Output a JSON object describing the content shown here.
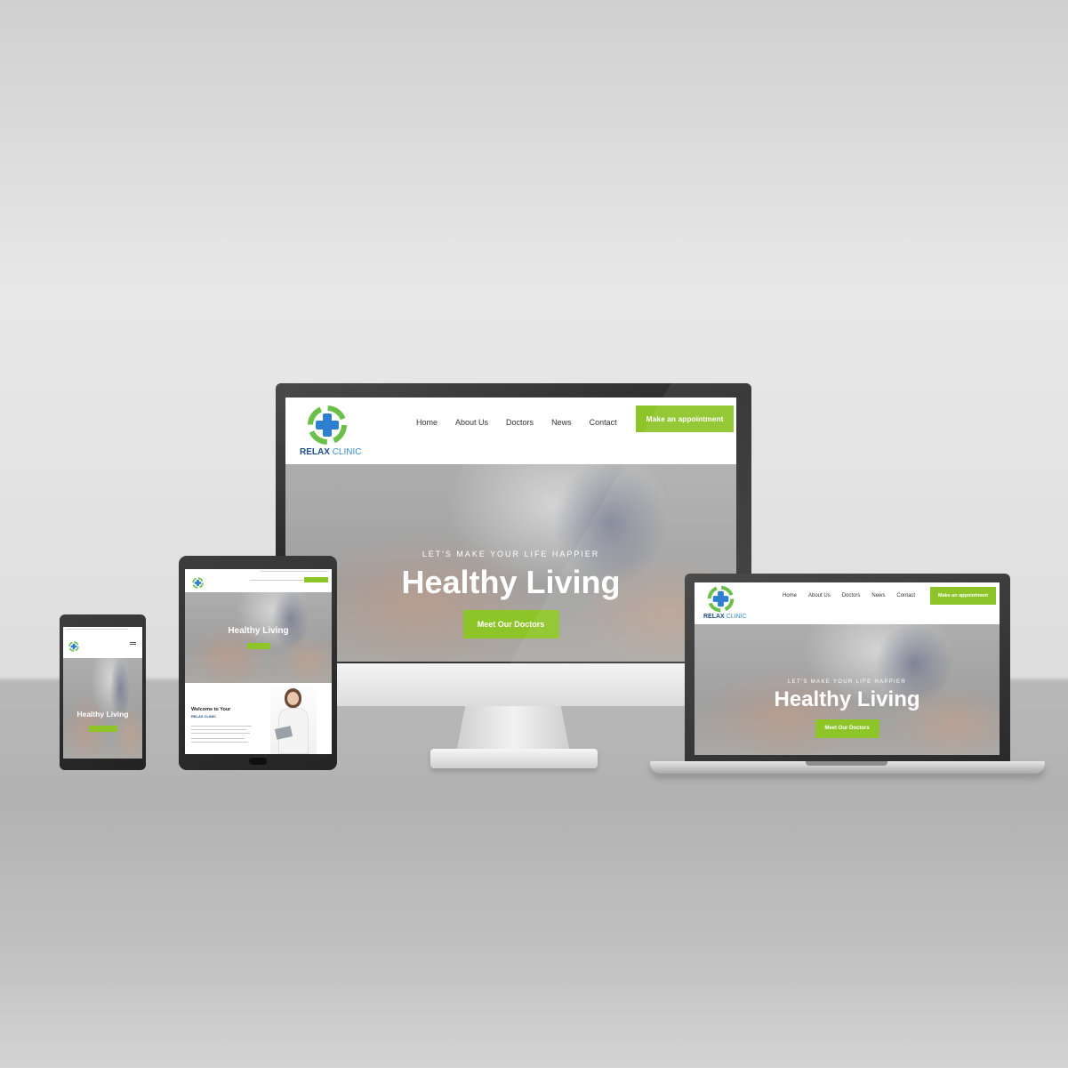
{
  "brand": {
    "word1": "RELAX",
    "word2": "CLINIC"
  },
  "nav": {
    "items": [
      "Home",
      "About Us",
      "Doctors",
      "News",
      "Contact"
    ],
    "cta": "Make an appointment"
  },
  "hero": {
    "tagline": "LET'S MAKE YOUR LIFE HAPPIER",
    "title": "Healthy Living",
    "button": "Meet Our Doctors"
  },
  "tablet": {
    "welcome_line1": "Welcome to Your",
    "welcome_line2": "RELAX CLINIC"
  },
  "colors": {
    "accent": "#8dc428",
    "logo_dark": "#1c4c8c",
    "logo_light": "#3a8fd1",
    "logo_ring": "#6cc04a"
  },
  "icons": [
    "medical-cross-icon"
  ]
}
